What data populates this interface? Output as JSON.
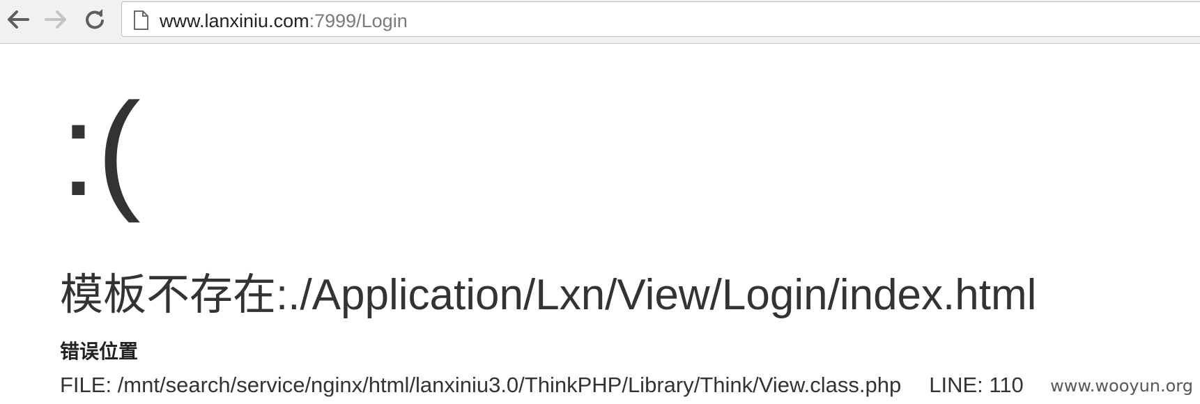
{
  "browser": {
    "back_icon": "arrow-left-icon",
    "forward_icon": "arrow-right-icon",
    "reload_icon": "reload-icon",
    "page_icon": "document-icon",
    "url_host": "www.lanxiniu.com",
    "url_rest": ":7999/Login"
  },
  "error": {
    "face": ":(",
    "message": "模板不存在:./Application/Lxn/View/Login/index.html",
    "location_title": "错误位置",
    "file": "FILE: /mnt/search/service/nginx/html/lanxiniu3.0/ThinkPHP/Library/Think/View.class.php",
    "line": "LINE: 110"
  },
  "watermark": "www.wooyun.org"
}
